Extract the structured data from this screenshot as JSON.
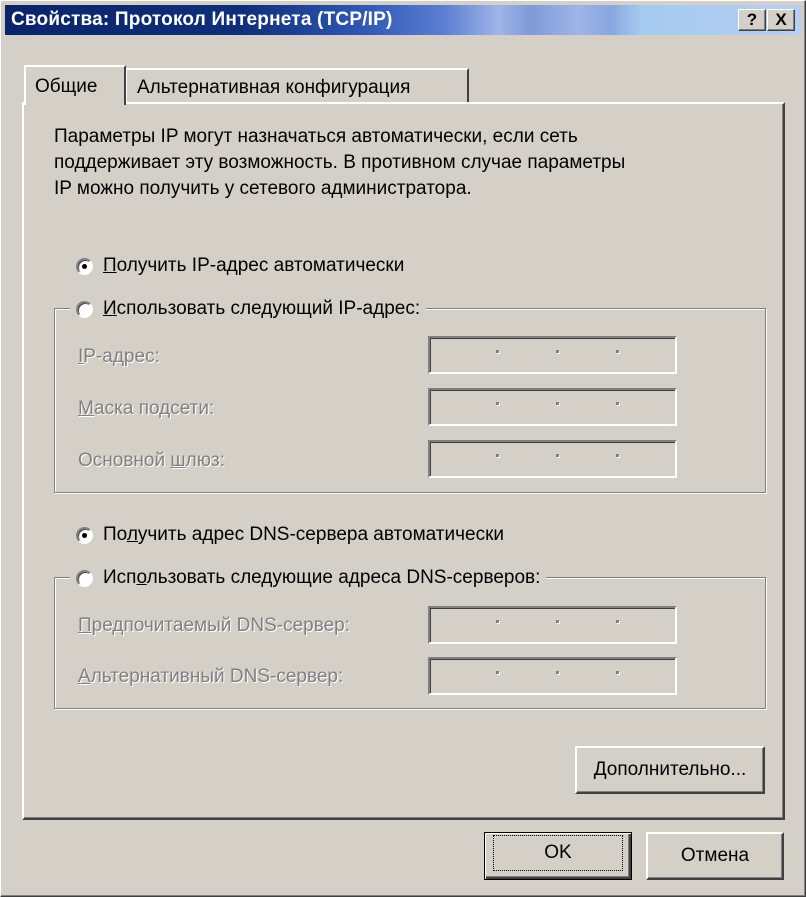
{
  "window": {
    "title": "Свойства: Протокол Интернета (TCP/IP)",
    "help_button": "?",
    "close_button": "X"
  },
  "tabs": [
    {
      "label": "Общие",
      "active": true
    },
    {
      "label": "Альтернативная конфигурация",
      "active": false
    }
  ],
  "description": [
    "Параметры IP могут назначаться автоматически, если сеть",
    "поддерживает эту возможность. В противном случае параметры",
    "IP можно получить у сетевого администратора."
  ],
  "ip": {
    "auto_prefix": "",
    "auto_hotkey": "П",
    "auto_rest": "олучить IP-адрес автоматически",
    "manual_prefix": "",
    "manual_hotkey": "И",
    "manual_rest": "спользовать следующий IP-адрес:",
    "fields": [
      {
        "label_hotkey": "I",
        "label_rest": "P-адрес:"
      },
      {
        "label_hotkey": "М",
        "label_rest": "аска подсети:"
      },
      {
        "label_prefix": "Основной ",
        "label_hotkey": "ш",
        "label_rest": "люз:"
      }
    ],
    "selected": "auto"
  },
  "dns": {
    "auto_prefix": "По",
    "auto_hotkey": "л",
    "auto_rest": "учить адрес DNS-сервера автоматически",
    "manual_prefix": "Исп",
    "manual_hotkey": "о",
    "manual_rest": "льзовать следующие адреса DNS-серверов:",
    "fields": [
      {
        "label_hotkey": "П",
        "label_rest": "редпочитаемый DNS-сервер:"
      },
      {
        "label_hotkey": "А",
        "label_rest": "льтернативный DNS-сервер:"
      }
    ],
    "selected": "auto"
  },
  "buttons": {
    "advanced_hotkey": "Д",
    "advanced_rest": "ополнительно...",
    "ok": "OK",
    "cancel": "Отмена"
  },
  "colors": {
    "face": "#d4d0c8",
    "title_active": "#0a246a",
    "disabled_text": "#808080"
  }
}
